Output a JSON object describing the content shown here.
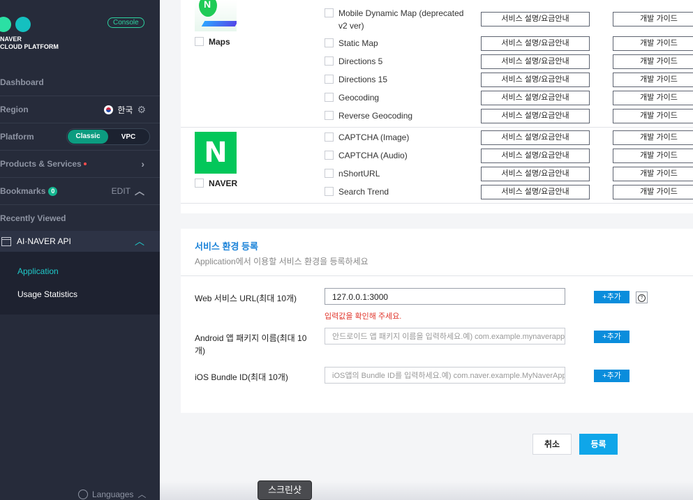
{
  "sidebar": {
    "brand_line1": "NAVER",
    "brand_line2": "CLOUD PLATFORM",
    "console_label": "Console",
    "dashboard": "Dashboard",
    "region_label": "Region",
    "region_value": "한국",
    "platform_label": "Platform",
    "platform_options": [
      "Classic",
      "VPC"
    ],
    "platform_selected": "Classic",
    "products": "Products & Services",
    "bookmarks": "Bookmarks",
    "bookmarks_count": "0",
    "edit": "EDIT",
    "recently_viewed": "Recently Viewed",
    "api_section": "AI·NAVER API",
    "sub_items": [
      "Application",
      "Usage Statistics"
    ],
    "languages": "Languages",
    "accent": "#14b690"
  },
  "products": {
    "maps": {
      "name": "Maps",
      "apis": [
        "Mobile Dynamic Map (deprecated v2 ver)",
        "Static Map",
        "Directions 5",
        "Directions 15",
        "Geocoding",
        "Reverse Geocoding"
      ]
    },
    "naver": {
      "name": "NAVER",
      "logo_letter": "N",
      "apis": [
        "CAPTCHA (Image)",
        "CAPTCHA (Audio)",
        "nShortURL",
        "Search Trend"
      ]
    },
    "service_button": "서비스 설명/요금안내",
    "guide_button": "개발 가이드"
  },
  "env": {
    "title": "서비스 환경 등록",
    "subtitle": "Application에서 이용할 서비스 환경을 등록하세요",
    "web_label": "Web 서비스 URL(최대 10개)",
    "web_value": "127.0.0.1:3000",
    "web_error": "입력값을 확인해 주세요.",
    "android_label": "Android 앱 패키지 이름(최대 10개)",
    "android_placeholder": "안드로이드 앱 패키지 이름을 입력하세요.예) com.example.mynaverapp",
    "ios_label": "iOS Bundle ID(최대 10개)",
    "ios_placeholder": "iOS앱의 Bundle ID를 입력하세요.예) com.naver.example.MyNaverApp",
    "add_label": "+추가",
    "help_icon": "?"
  },
  "actions": {
    "cancel": "취소",
    "submit": "등록"
  },
  "tooltip": "스크린샷"
}
